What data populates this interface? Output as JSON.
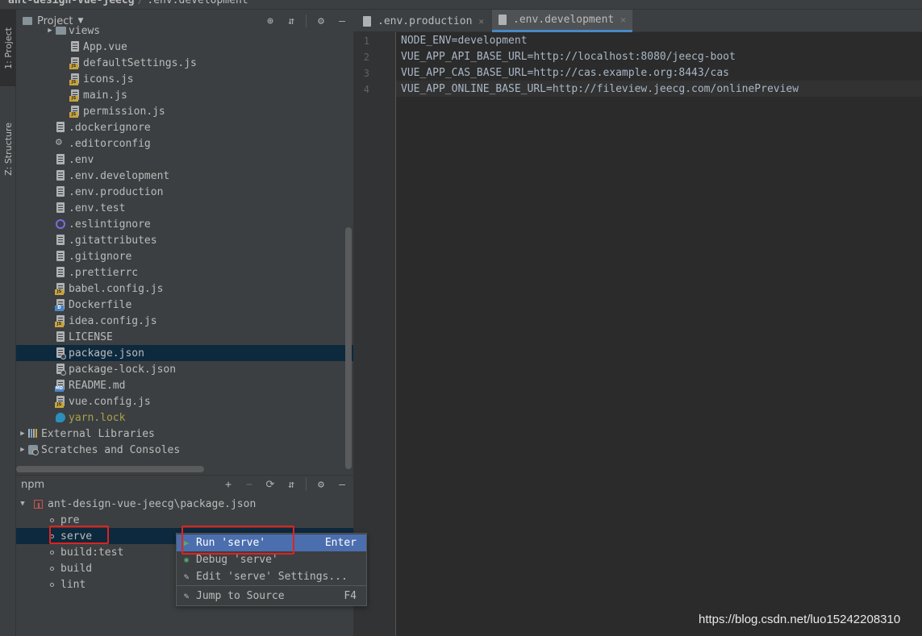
{
  "breadcrumb": {
    "project": "ant-design-vue-jeecg",
    "file": ".env.development"
  },
  "toolstrip": {
    "tab_project": "1: Project",
    "tab_structure": "Z: Structure"
  },
  "project_panel": {
    "title": "Project",
    "tree": [
      {
        "label": "views",
        "type": "folder",
        "indent": 2,
        "arrow": "▶"
      },
      {
        "label": "App.vue",
        "type": "file",
        "indent": 3
      },
      {
        "label": "defaultSettings.js",
        "type": "js",
        "indent": 3
      },
      {
        "label": "icons.js",
        "type": "js",
        "indent": 3
      },
      {
        "label": "main.js",
        "type": "js",
        "indent": 3
      },
      {
        "label": "permission.js",
        "type": "js",
        "indent": 3
      },
      {
        "label": ".dockerignore",
        "type": "file",
        "indent": 2
      },
      {
        "label": ".editorconfig",
        "type": "gear",
        "indent": 2
      },
      {
        "label": ".env",
        "type": "file",
        "indent": 2
      },
      {
        "label": ".env.development",
        "type": "file",
        "indent": 2
      },
      {
        "label": ".env.production",
        "type": "file",
        "indent": 2
      },
      {
        "label": ".env.test",
        "type": "file",
        "indent": 2
      },
      {
        "label": ".eslintignore",
        "type": "eslint",
        "indent": 2
      },
      {
        "label": ".gitattributes",
        "type": "file",
        "indent": 2
      },
      {
        "label": ".gitignore",
        "type": "file",
        "indent": 2
      },
      {
        "label": ".prettierrc",
        "type": "file",
        "indent": 2
      },
      {
        "label": "babel.config.js",
        "type": "js",
        "indent": 2
      },
      {
        "label": "Dockerfile",
        "type": "docker",
        "indent": 2
      },
      {
        "label": "idea.config.js",
        "type": "js",
        "indent": 2
      },
      {
        "label": "LICENSE",
        "type": "file",
        "indent": 2
      },
      {
        "label": "package.json",
        "type": "json",
        "indent": 2,
        "selected": true
      },
      {
        "label": "package-lock.json",
        "type": "json",
        "indent": 2
      },
      {
        "label": "README.md",
        "type": "md",
        "indent": 2
      },
      {
        "label": "vue.config.js",
        "type": "js",
        "indent": 2
      },
      {
        "label": "yarn.lock",
        "type": "yarn",
        "indent": 2,
        "yellow": true
      },
      {
        "label": "External Libraries",
        "type": "libs",
        "indent": 0,
        "arrow": "▶"
      },
      {
        "label": "Scratches and Consoles",
        "type": "scratch",
        "indent": 0,
        "arrow": "▶"
      }
    ]
  },
  "npm_panel": {
    "title": "npm",
    "root": "ant-design-vue-jeecg\\package.json",
    "scripts": [
      "pre",
      "serve",
      "build:test",
      "build",
      "lint"
    ],
    "selected_script": "serve"
  },
  "editor": {
    "tabs": [
      {
        "label": ".env.production",
        "active": false
      },
      {
        "label": ".env.development",
        "active": true
      }
    ],
    "line_numbers": [
      "1",
      "2",
      "3",
      "4"
    ],
    "lines": [
      "NODE_ENV=development",
      "VUE_APP_API_BASE_URL=http://localhost:8080/jeecg-boot",
      "VUE_APP_CAS_BASE_URL=http://cas.example.org:8443/cas",
      "VUE_APP_ONLINE_BASE_URL=http://fileview.jeecg.com/onlinePreview"
    ]
  },
  "context_menu": {
    "run": {
      "label": "Run 'serve'",
      "shortcut": "Enter"
    },
    "debug": {
      "label": "Debug 'serve'",
      "shortcut": ""
    },
    "edit": {
      "label": "Edit 'serve' Settings...",
      "shortcut": ""
    },
    "jump": {
      "label": "Jump to Source",
      "shortcut": "F4"
    }
  },
  "watermark": "https://blog.csdn.net/luo15242208310",
  "colors": {
    "accent": "#4b6eaf",
    "selection": "#0d293e",
    "highlight_box": "#e0221d"
  }
}
